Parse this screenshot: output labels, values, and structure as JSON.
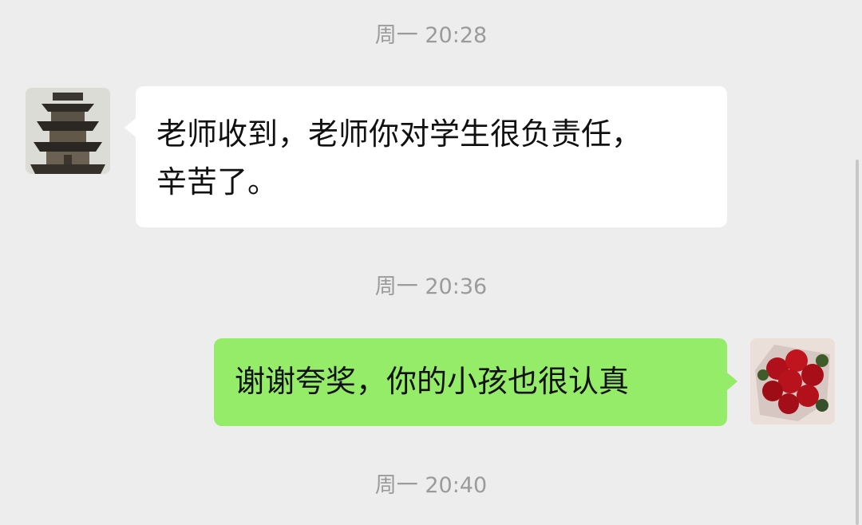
{
  "messages": [
    {
      "timestamp": "周一 20:28"
    },
    {
      "sender": "contact",
      "avatar_icon": "pagoda-avatar-icon",
      "lines": [
        "老师收到，老师你对学生很负责任，",
        "辛苦了。"
      ]
    },
    {
      "timestamp": "周一 20:36"
    },
    {
      "sender": "self",
      "avatar_icon": "roses-avatar-icon",
      "text": "谢谢夸奖，你的小孩也很认真"
    },
    {
      "timestamp": "周一 20:40"
    }
  ]
}
